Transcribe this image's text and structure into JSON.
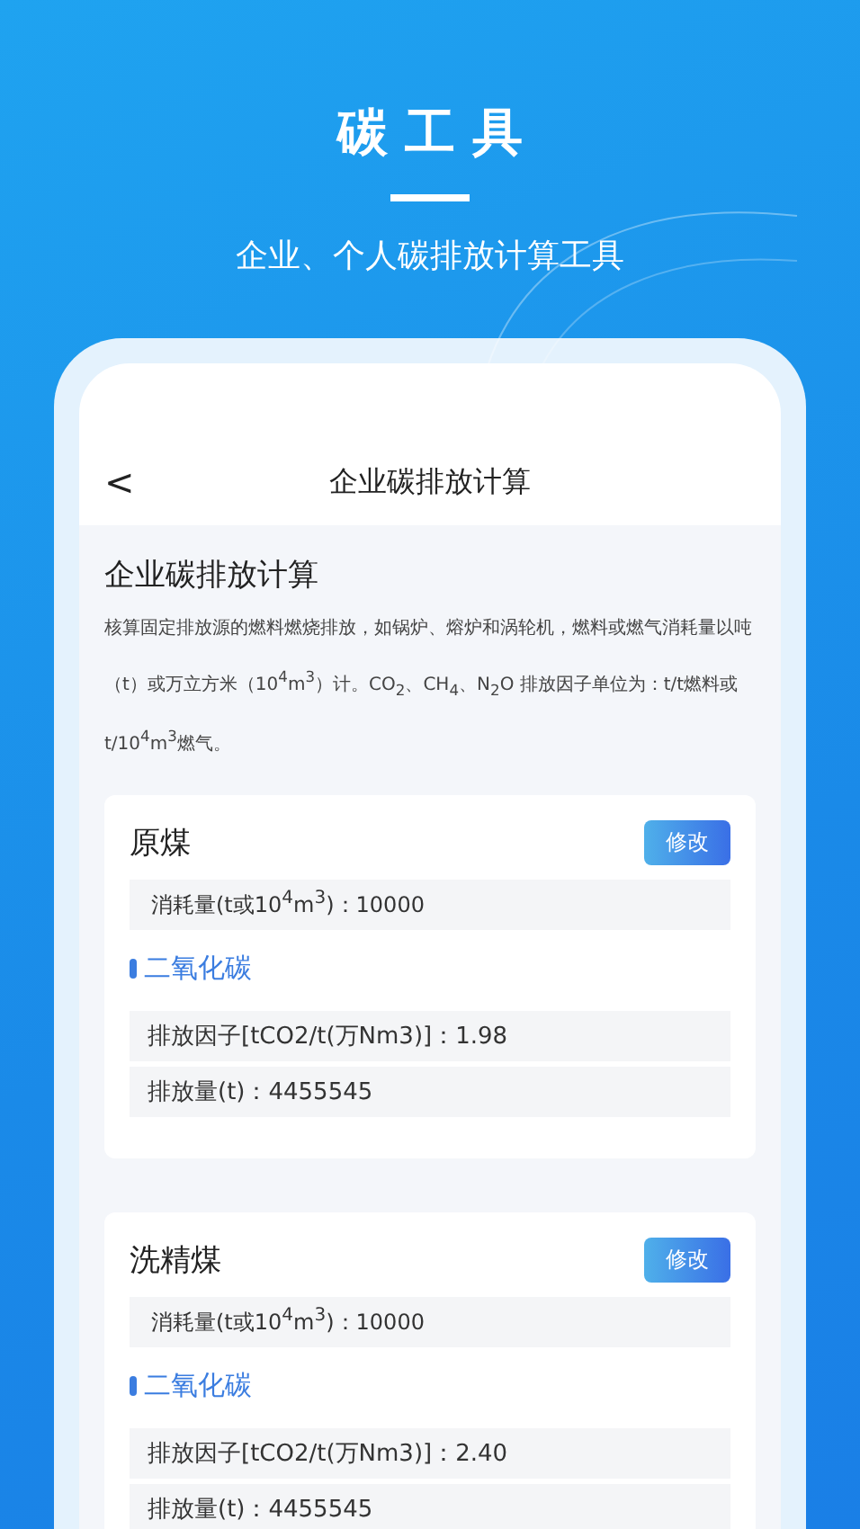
{
  "header": {
    "title": "碳 工 具",
    "subtitle": "企业、个人碳排放计算工具"
  },
  "nav": {
    "back": "<",
    "title": "企业碳排放计算"
  },
  "intro": {
    "title": "企业碳排放计算",
    "text": "核算固定排放源的燃料燃烧排放，如锅炉、熔炉和涡轮机，燃料或燃气消耗量以吨（t）或万立方米（10$^{4}$m$^{3}$）计。CO$_{2}$、CH$_{4}$、N$_{2}$O 排放因子单位为：t/t燃料或t/10$^{4}$m$^{3}$燃气。"
  },
  "cards": [
    {
      "name": "原煤",
      "button": "修改",
      "consumption": "消耗量(t或10$^{4}$m$^{3}$)：10000",
      "gas": "二氧化碳",
      "rows": [
        "排放因子[tCO2/t(万Nm3)]：1.98",
        "排放量(t)：4455545"
      ]
    },
    {
      "name": "洗精煤",
      "button": "修改",
      "consumption": "消耗量(t或10$^{4}$m$^{3}$)：10000",
      "gas": "二氧化碳",
      "rows": [
        "排放因子[tCO2/t(万Nm3)]：2.40",
        "排放量(t)：4455545"
      ]
    }
  ]
}
